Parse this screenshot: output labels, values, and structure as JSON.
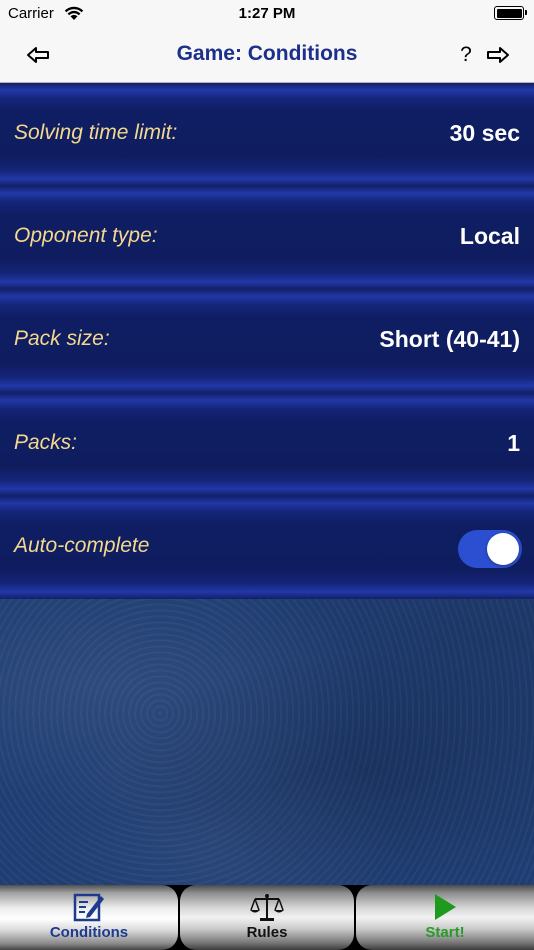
{
  "status_bar": {
    "carrier": "Carrier",
    "time": "1:27 PM"
  },
  "navbar": {
    "title": "Game: Conditions",
    "help_label": "?",
    "back_icon": "arrow-left-icon",
    "forward_icon": "arrow-right-icon"
  },
  "settings": [
    {
      "label": "Solving time limit:",
      "value": "30 sec"
    },
    {
      "label": "Opponent type:",
      "value": "Local"
    },
    {
      "label": "Pack size:",
      "value": "Short (40-41)"
    },
    {
      "label": "Packs:",
      "value": "1"
    },
    {
      "label": "Auto-complete",
      "toggle": true
    }
  ],
  "tabs": [
    {
      "label": "Conditions",
      "icon": "edit-form-icon",
      "selected": true
    },
    {
      "label": "Rules",
      "icon": "scales-icon",
      "selected": false
    },
    {
      "label": "Start!",
      "icon": "play-icon",
      "selected": false
    }
  ],
  "colors": {
    "title": "#1c2f8a",
    "row_label": "#f4d88e",
    "row_value": "#ffffff",
    "toggle_on": "#2c4fd1",
    "felt": "#1f3d73",
    "tab_selected_label": "#1d3a8f",
    "tab_start_label": "#2a9a2a"
  }
}
